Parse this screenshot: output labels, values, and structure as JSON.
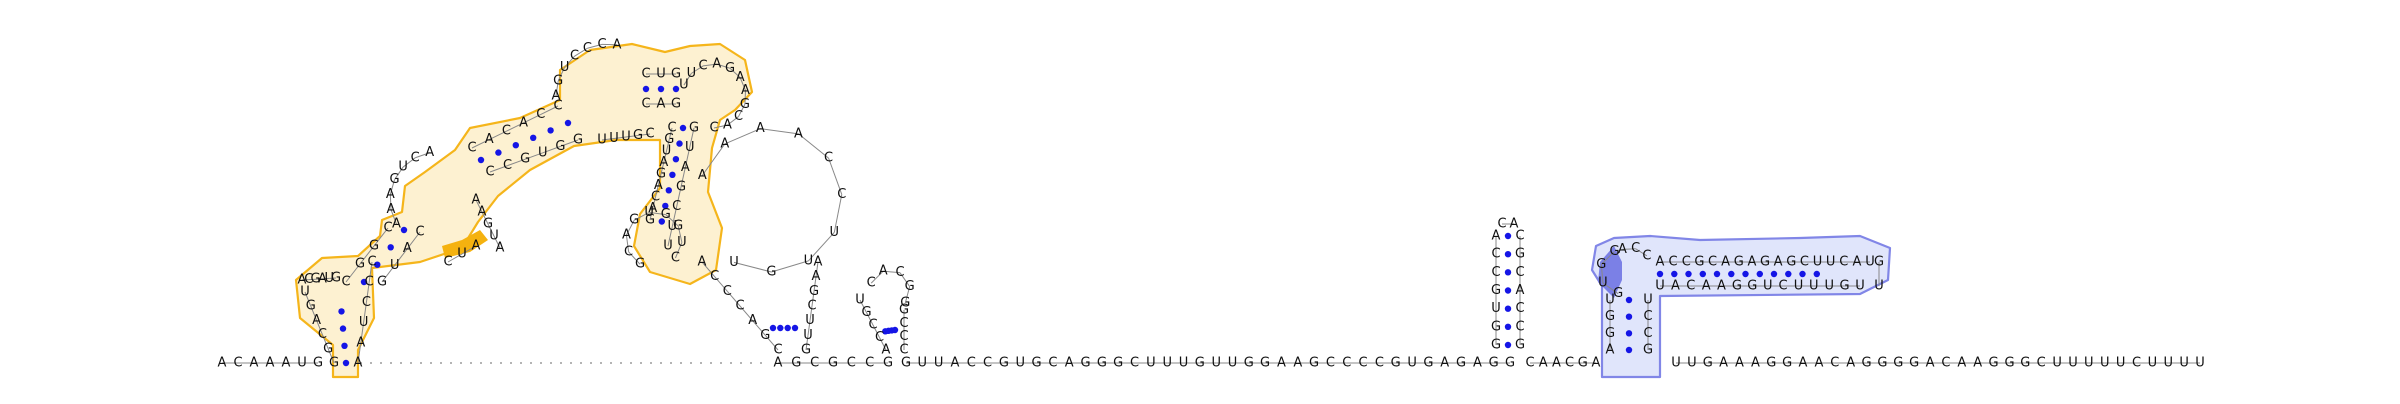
{
  "colors": {
    "highlight_orange": "#f5b20f",
    "highlight_orange_fill": "#fdf1cf",
    "highlight_blue": "#7b80e6",
    "highlight_blue_fill": "#dfe4fb",
    "base_pair_dot": "#1515e6"
  },
  "diagram": {
    "baseline_5prime": "ACAAAUG",
    "baseline_3prime": "GUUACCGUGCAGGGCUUUGUUGGAAGCCCCGUGAGAGG",
    "linker": "CAACGA",
    "tail": "UUGAAAGGAACAGGGGACAAGGGCUUUUUCUUUU",
    "domain1": {
      "stem1_left": "GGCAGU",
      "stem1_right": "CCCUAA",
      "loop1": "ACGAUG",
      "stem2_left": "CGGC",
      "stem2_right": "CAUG",
      "loop2": "AAAGUCA",
      "bulge_highlight": "CUA",
      "stem3_left": "CACACC",
      "stem3_right": "GGUGCC",
      "stem4_left": "AGUCCCA",
      "stem4_right": "UUUGC",
      "loop4": "CUG",
      "stem5_right": "GAC",
      "hairpin": "UUCAGAAGCAC",
      "inner_left": "CGUAGACAG",
      "inner_loop": "GCAGUGGUC",
      "inner_right": "UUCGAUG"
    },
    "domain2": {
      "loop_big": "AAAACCUUGU",
      "stem_left": "ACCCAGC",
      "stem_right": "AAGCUUG",
      "small_hairpin": "UGCCACGG",
      "small_hairpin_right": "GCCC"
    },
    "domain3": {
      "stem_left": "GGUGCCA",
      "stem_right": "CGCACCG",
      "loop": "CA"
    },
    "domain4": {
      "stem_a_left": "AGGU",
      "stem_a_right": "UCCG",
      "loop_highlight": "GUGG",
      "stem_b_top": "ACCGCAGAGAGCUUCAU",
      "stem_b_bottom": "UGUUUCUGGAACAU",
      "loop_end": "GU"
    }
  }
}
